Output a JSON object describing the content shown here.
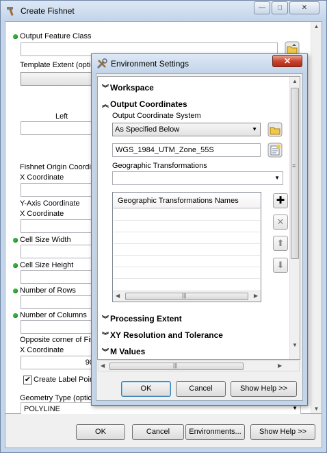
{
  "fishnet": {
    "title": "Create Fishnet",
    "min_glyph": "—",
    "max_glyph": "□",
    "close_glyph": "✕",
    "labels": {
      "output_feature_class": "Output Feature Class",
      "template_extent": "Template Extent (optio",
      "left": "Left",
      "origin_coord": "Fishnet Origin Coordin",
      "x_coordinate_1": "X Coordinate",
      "y_axis_coordinate": "Y-Axis Coordinate",
      "x_coordinate_2": "X Coordinate",
      "cell_size_width": "Cell Size Width",
      "cell_size_height": "Cell Size Height",
      "number_of_rows": "Number of Rows",
      "number_of_columns": "Number of Columns",
      "opposite_corner": "Opposite corner of Fis",
      "x_coordinate_3": "X Coordinate",
      "create_label_points": "Create Label Poin",
      "geometry_type": "Geometry Type (optic"
    },
    "values": {
      "opposite_x": "90",
      "geometry_type": "POLYLINE"
    },
    "buttons": {
      "ok": "OK",
      "cancel": "Cancel",
      "environments": "Environments...",
      "show_help": "Show Help >>"
    }
  },
  "env": {
    "title": "Environment Settings",
    "close_glyph": "✕",
    "sections": {
      "workspace": "Workspace",
      "output_coordinates": "Output Coordinates",
      "processing_extent": "Processing Extent",
      "xy_resolution": "XY Resolution and Tolerance",
      "m_values": "M Values"
    },
    "labels": {
      "output_coordinate_system": "Output Coordinate System",
      "geographic_transformations": "Geographic Transformations",
      "transformations_names": "Geographic Transformations Names"
    },
    "values": {
      "coordinate_mode": "As Specified Below",
      "coordinate_system": "WGS_1984_UTM_Zone_55S",
      "geographic_transformation": ""
    },
    "buttons": {
      "ok": "OK",
      "cancel": "Cancel",
      "show_help": "Show Help >>"
    },
    "glyphs": {
      "add": "✚",
      "remove": "✕",
      "up": "⬆",
      "down": "⬇",
      "expand": "»",
      "scroll_grip": "|||"
    }
  },
  "colors": {
    "required_dot": "#2fb43a",
    "title_bar": "#c3d4e9",
    "close_button": "#c7402a"
  }
}
